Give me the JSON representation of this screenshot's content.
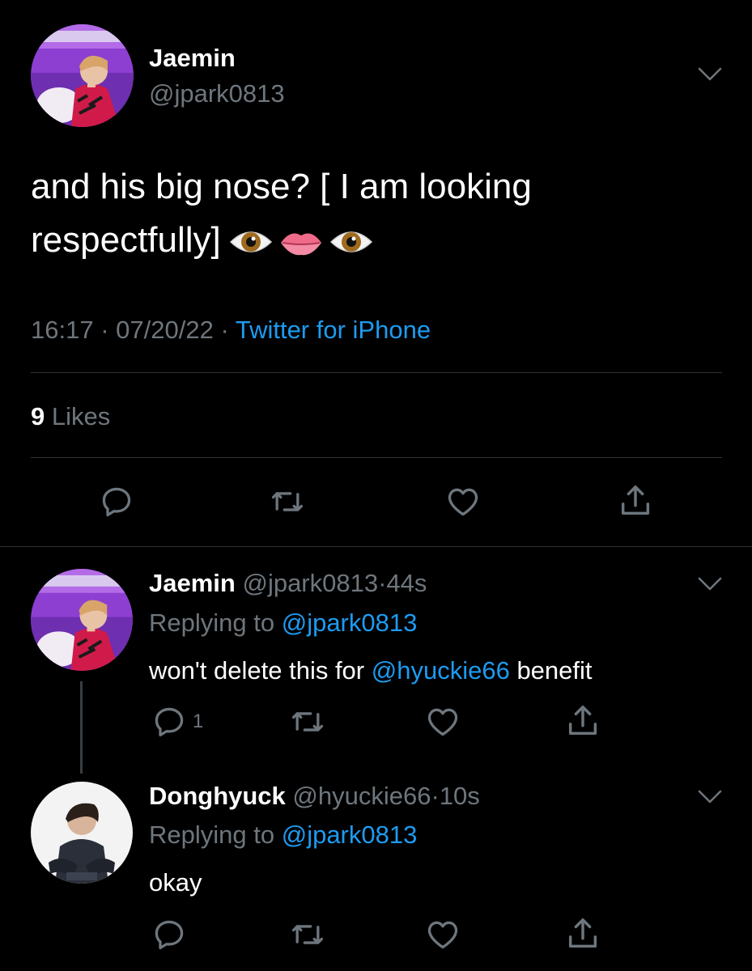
{
  "main_tweet": {
    "display_name": "Jaemin",
    "handle": "@jpark0813",
    "text": "and his big nose? [ I am looking respectfully]",
    "emojis": [
      "eye-emoji",
      "lips-emoji",
      "eye-emoji"
    ],
    "time": "16:17",
    "date": "07/20/22",
    "source": "Twitter for iPhone",
    "likes_count": "9",
    "likes_label": "Likes"
  },
  "replies": [
    {
      "display_name": "Jaemin",
      "handle": "@jpark0813",
      "age": "44s",
      "replying_label": "Replying to",
      "replying_to": "@jpark0813",
      "text_before": "won't delete this for",
      "mention": "@hyuckie66",
      "text_after": "benefit",
      "reply_count": "1"
    },
    {
      "display_name": "Donghyuck",
      "handle": "@hyuckie66",
      "age": "10s",
      "replying_label": "Replying to",
      "replying_to": "@jpark0813",
      "text": "okay"
    }
  ],
  "separators": {
    "dot": "·"
  },
  "colors": {
    "background": "#000000",
    "link": "#1d9bf0",
    "muted": "#6e767d",
    "divider": "#2f3336"
  },
  "icons": [
    "chevron-down-icon",
    "reply-icon",
    "retweet-icon",
    "like-icon",
    "share-icon"
  ]
}
